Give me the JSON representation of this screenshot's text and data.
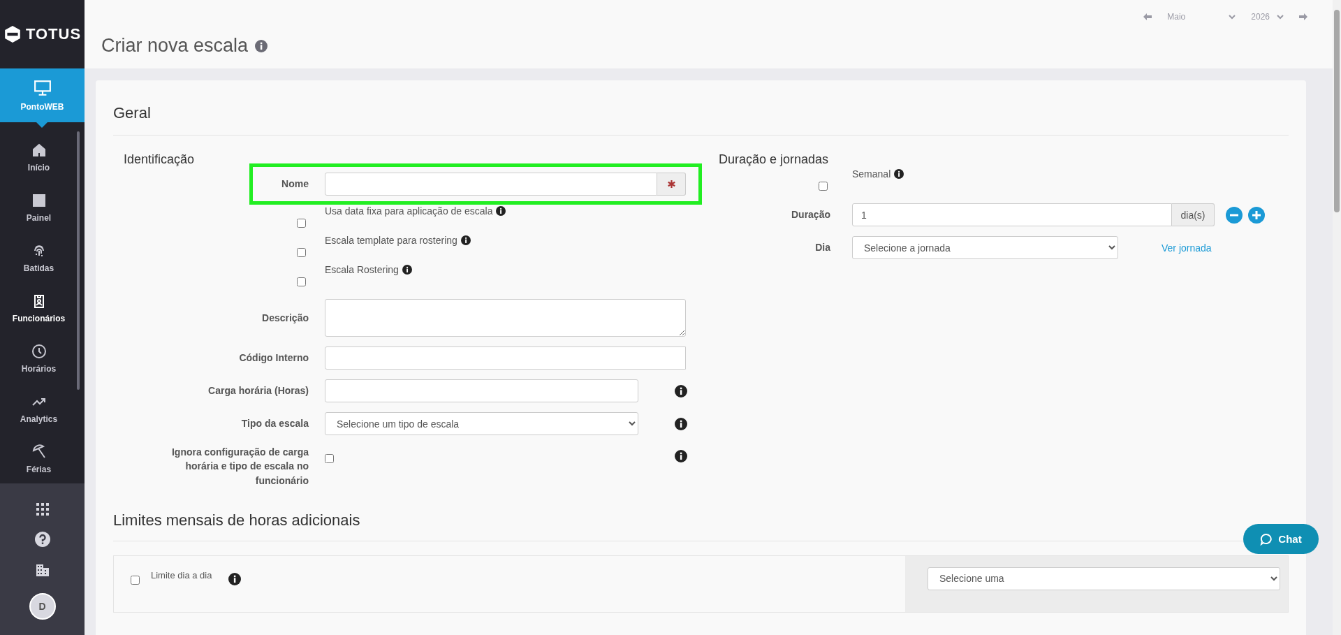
{
  "sidebar": {
    "logo": "TOTUS",
    "module": "PontoWEB",
    "items": [
      {
        "label": "Início",
        "selected": false
      },
      {
        "label": "Painel",
        "selected": false
      },
      {
        "label": "Batidas",
        "selected": false
      },
      {
        "label": "Funcionários",
        "selected": true
      },
      {
        "label": "Horários",
        "selected": false
      },
      {
        "label": "Analytics",
        "selected": false
      },
      {
        "label": "Férias",
        "selected": false
      }
    ],
    "avatar": "D"
  },
  "header": {
    "title": "Criar nova escala",
    "month": "Maio",
    "year": "2026"
  },
  "section": {
    "title": "Geral"
  },
  "identificacao": {
    "title": "Identificação",
    "fields": [
      {
        "kind": "text",
        "label": "Nome",
        "required": true,
        "highlighted": true
      },
      {
        "kind": "check",
        "label": "Usa data fixa para aplicação de escala",
        "checked": false
      },
      {
        "kind": "check",
        "label": "Escala template para rostering",
        "checked": false
      },
      {
        "kind": "check",
        "label": "Escala Rostering",
        "checked": false
      },
      {
        "kind": "textarea",
        "label": "Descrição"
      },
      {
        "kind": "text",
        "label": "Código Interno"
      },
      {
        "kind": "text_info",
        "label": "Carga horária (Horas)"
      },
      {
        "kind": "select_info",
        "label": "Tipo da escala",
        "value": "Selecione um tipo de escala"
      },
      {
        "kind": "checkbox_info",
        "label": "Ignora configuração de carga horária e tipo de escala no funcionário",
        "checked": false
      }
    ]
  },
  "duracao": {
    "title": "Duração e jornadas",
    "semanal": {
      "label": "Semanal",
      "checked": false
    },
    "duracao": {
      "label": "Duração",
      "value": "1",
      "unit": "dia(s)"
    },
    "dia": {
      "label": "Dia",
      "value": "Selecione a jornada",
      "link": "Ver jornada"
    }
  },
  "limites": {
    "title": "Limites mensais de horas adicionais",
    "limite": {
      "label": "Limite dia a dia",
      "checked": false
    },
    "select": "Selecione uma"
  },
  "chat": "Chat"
}
